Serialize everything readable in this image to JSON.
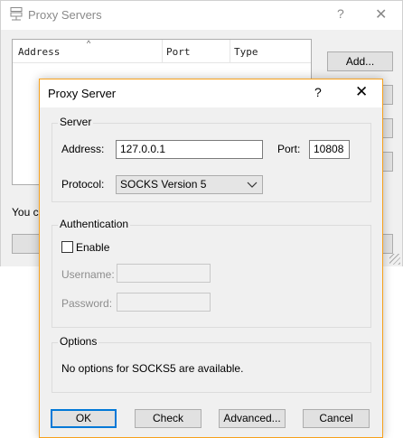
{
  "background_window": {
    "title": "Proxy Servers",
    "help_glyph": "?",
    "close_glyph": "✕",
    "list_columns": [
      "Address",
      "Port",
      "Type"
    ],
    "sort_glyph": "^",
    "add_button": "Add...",
    "hint_text": "You ca"
  },
  "dialog": {
    "title": "Proxy Server",
    "help_glyph": "?",
    "close_glyph": "✕",
    "server": {
      "group_label": "Server",
      "address_label": "Address:",
      "address_value": "127.0.0.1",
      "port_label": "Port:",
      "port_value": "10808",
      "protocol_label": "Protocol:",
      "protocol_value": "SOCKS Version 5"
    },
    "authentication": {
      "group_label": "Authentication",
      "enable_label": "Enable",
      "enable_checked": false,
      "username_label": "Username:",
      "username_value": "",
      "password_label": "Password:",
      "password_value": ""
    },
    "options": {
      "group_label": "Options",
      "message": "No options for SOCKS5 are available."
    },
    "buttons": {
      "ok": "OK",
      "check": "Check",
      "advanced": "Advanced...",
      "cancel": "Cancel"
    }
  },
  "colors": {
    "dialog_border_accent": "#f7a11c",
    "default_button_border": "#0078d7",
    "dialog_face": "#f0f0f0"
  }
}
